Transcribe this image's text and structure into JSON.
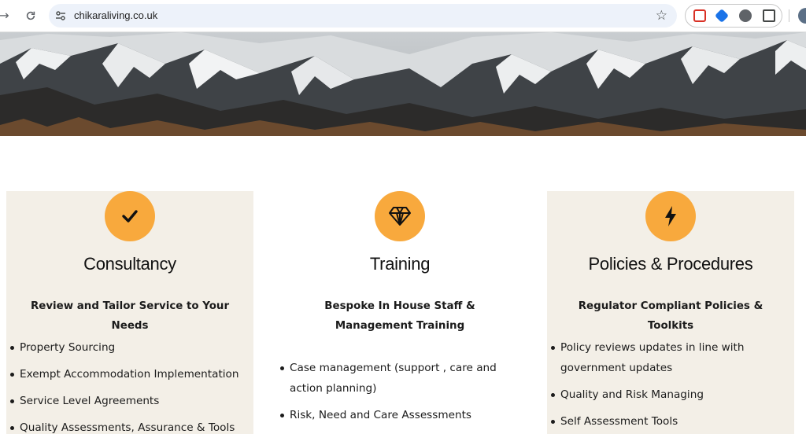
{
  "browser": {
    "url": "chikaraliving.co.uk",
    "icons": [
      "back-arrow-icon",
      "reload-icon",
      "site-settings-icon",
      "bookmark-star-icon",
      "extension-shield-icon",
      "extension-translate-icon",
      "extension-circle-icon",
      "extensions-puzzle-icon",
      "profile-avatar-icon"
    ]
  },
  "colors": {
    "accent_orange": "#f8a93d",
    "card_beige": "#f3efe7",
    "text_dark": "#111111"
  },
  "services": [
    {
      "title": "Consultancy",
      "icon": "checkmark-icon",
      "subtitle": "Review and Tailor Service to Your Needs",
      "items": [
        "Property Sourcing",
        "Exempt Accommodation Implementation",
        "Service Level Agreements",
        "Quality Assessments, Assurance & Tools"
      ]
    },
    {
      "title": "Training",
      "icon": "diamond-icon",
      "subtitle": "Bespoke In House Staff & Management Training",
      "items": [
        "Case management (support , care and action planning)",
        "Risk, Need and Care Assessments"
      ]
    },
    {
      "title": "Policies & Procedures",
      "icon": "lightning-bolt-icon",
      "subtitle": "Regulator Compliant Policies & Toolkits",
      "items": [
        "Policy reviews updates in line with government updates",
        "Quality and Risk Managing",
        "Self Assessment Tools"
      ]
    }
  ]
}
